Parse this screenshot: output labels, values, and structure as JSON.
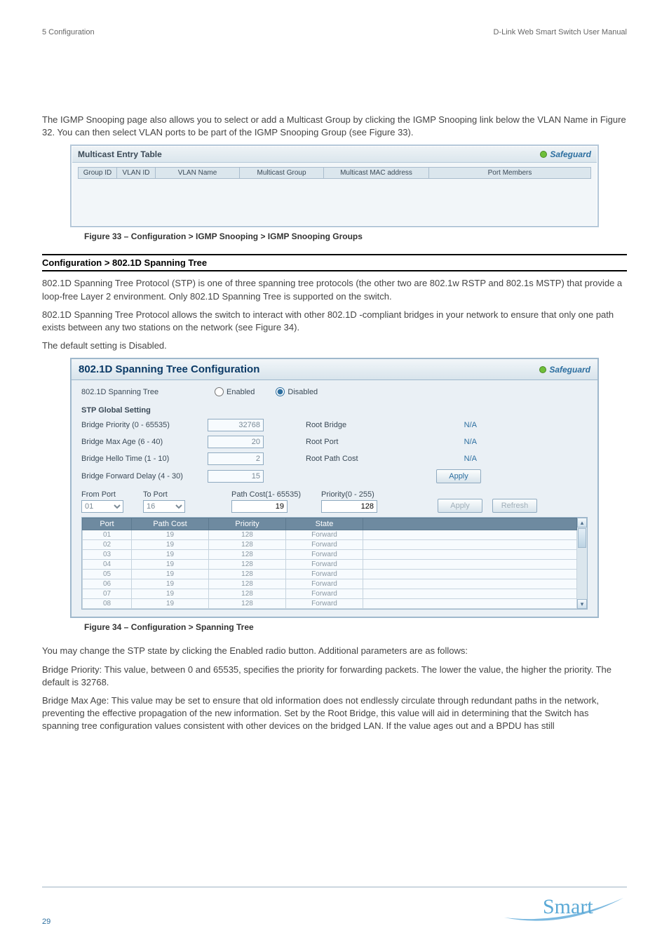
{
  "meta": {
    "left": "5  Configuration",
    "right": "D-Link Web Smart Switch User Manual"
  },
  "intro_para": "The IGMP Snooping page also allows you to select or add a Multicast Group by clicking the IGMP Snooping link below the VLAN Name in Figure 32. You can then select VLAN ports to be part of the IGMP Snooping Group (see Figure 33).",
  "mc_panel": {
    "title": "Multicast Entry Table",
    "safeguard": "Safeguard",
    "headers": [
      "Group ID",
      "VLAN ID",
      "VLAN Name",
      "Multicast Group",
      "Multicast MAC address",
      "Port Members"
    ]
  },
  "fig33": "Figure 33 – Configuration > IGMP Snooping > IGMP Snooping Groups",
  "section": "Configuration > 802.1D Spanning Tree",
  "stp_desc": [
    "802.1D Spanning Tree Protocol (STP) is one of three spanning tree protocols (the other two are 802.1w RSTP and 802.1s MSTP) that provide a loop-free Layer 2 environment. Only 802.1D Spanning Tree is supported on the switch.",
    "802.1D Spanning Tree Protocol allows the switch to interact with other 802.1D -compliant bridges in your network to ensure that only one path exists between any two stations on the network (see Figure 34).",
    "The default setting is Disabled."
  ],
  "stp_panel": {
    "title": "802.1D Spanning Tree Configuration",
    "safeguard": "Safeguard",
    "radio": {
      "label": "802.1D Spanning Tree",
      "enabled": "Enabled",
      "disabled": "Disabled"
    },
    "subhead": "STP Global Setting",
    "rows": {
      "bp_label": "Bridge Priority (0 - 65535)",
      "bp_val": "32768",
      "bm_label": "Bridge Max Age (6 - 40)",
      "bm_val": "20",
      "bh_label": "Bridge Hello Time (1 - 10)",
      "bh_val": "2",
      "bf_label": "Bridge Forward  Delay (4 - 30)",
      "bf_val": "15",
      "rb_label": "Root Bridge",
      "rb_val": "N/A",
      "rp_label": "Root Port",
      "rp_val": "N/A",
      "rc_label": "Root Path Cost",
      "rc_val": "N/A",
      "apply": "Apply"
    },
    "portctl": {
      "from_label": "From Port",
      "from_val": "01",
      "to_label": "To Port",
      "to_val": "16",
      "pc_label": "Path Cost(1- 65535)",
      "pc_val": "19",
      "pr_label": "Priority(0 - 255)",
      "pr_val": "128",
      "apply": "Apply",
      "refresh": "Refresh"
    },
    "table": {
      "headers": [
        "Port",
        "Path Cost",
        "Priority",
        "State"
      ],
      "rows": [
        {
          "port": "01",
          "pc": "19",
          "pr": "128",
          "st": "Forward"
        },
        {
          "port": "02",
          "pc": "19",
          "pr": "128",
          "st": "Forward"
        },
        {
          "port": "03",
          "pc": "19",
          "pr": "128",
          "st": "Forward"
        },
        {
          "port": "04",
          "pc": "19",
          "pr": "128",
          "st": "Forward"
        },
        {
          "port": "05",
          "pc": "19",
          "pr": "128",
          "st": "Forward"
        },
        {
          "port": "06",
          "pc": "19",
          "pr": "128",
          "st": "Forward"
        },
        {
          "port": "07",
          "pc": "19",
          "pr": "128",
          "st": "Forward"
        },
        {
          "port": "08",
          "pc": "19",
          "pr": "128",
          "st": "Forward"
        }
      ]
    }
  },
  "fig34": "Figure 34 – Configuration > Spanning Tree",
  "after": [
    "You may change the STP state by clicking the Enabled radio button. Additional parameters are as follows:",
    "Bridge Priority: This value, between 0 and 65535, specifies the priority for forwarding packets. The lower the value, the higher the priority. The default is 32768.",
    "Bridge Max Age: This value may be set to ensure that old information does not endlessly circulate through redundant paths in the network, preventing the effective propagation of the new information. Set by the Root Bridge, this value will aid in determining that the Switch has spanning tree configuration values consistent with other devices on the bridged LAN. If the value ages out and a BPDU has still"
  ],
  "footer": {
    "page": "29",
    "brand": "Smart"
  }
}
